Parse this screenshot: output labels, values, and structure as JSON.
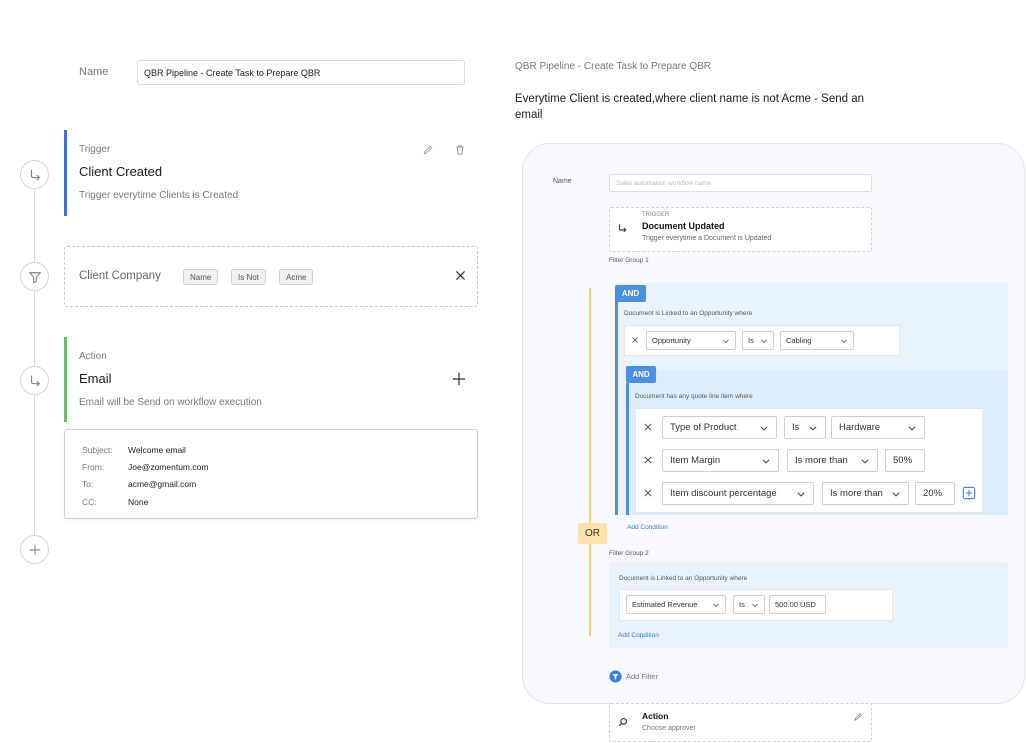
{
  "form": {
    "name_label": "Name",
    "name_value": "QBR Pipeline - Create Task to Prepare QBR"
  },
  "trigger": {
    "eyebrow": "Trigger",
    "title": "Client Created",
    "subtitle": "Trigger everytime Clients is Created",
    "accent": "#3b6fe0"
  },
  "filter": {
    "field": "Client Company",
    "chips": [
      "Name",
      "Is Not",
      "Acme"
    ]
  },
  "action": {
    "eyebrow": "Action",
    "title": "Email",
    "subtitle": "Email will be Send on workflow execution",
    "accent": "#6cc070"
  },
  "email": {
    "rows": [
      {
        "k": "Subject:",
        "v": "Welcome email"
      },
      {
        "k": "From:",
        "v": "Joe@zomentum.com"
      },
      {
        "k": "To:",
        "v": "acme@gmail.com"
      },
      {
        "k": "CC:",
        "v": "None"
      }
    ]
  },
  "right": {
    "crumb": "QBR Pipeline - Create Task to Prepare QBR",
    "description": "Everytime Client is created,where client name is not Acme - Send an email"
  },
  "screen": {
    "name_label": "Name",
    "name_placeholder": "Sales automation workflow name",
    "trigger_eyebrow": "TRIGGER",
    "trigger_title": "Document Updated",
    "trigger_sub": "Trigger everytime a  Document is Updated",
    "filter_group_1": "Filter Group 1",
    "and_label": "AND",
    "and_label_2": "AND",
    "group1_caption": "Document is Linked to an Opportunity where",
    "group1_row": {
      "field": "Opportunity",
      "op": "Is",
      "value": "Cabling"
    },
    "subgroup_caption": "Document has any quote line item where",
    "conditions": [
      {
        "field": "Type of Product",
        "op": "Is",
        "value": "Hardware"
      },
      {
        "field": "Item Margin",
        "op": "Is more than",
        "value": "50%"
      },
      {
        "field": "Item discount percentage",
        "op": "Is more than",
        "value": "20%"
      }
    ],
    "add_condition": "Add Condition",
    "or_label": "OR",
    "filter_group_2": "Filter Group 2",
    "group2_caption": "Document is Linked to an Opportunity where",
    "group2_row": {
      "field": "Estimated Revenue",
      "op": "Is",
      "value": "500.00 USD"
    },
    "add_condition_2": "Add Condition",
    "add_filter": "Add Filter",
    "action_title": "Action",
    "action_sub": "Choose approver"
  },
  "colors": {
    "accent_blue": "#4a90e2",
    "or_yellow": "#fde3a7",
    "group_bg": "#e9f3fc",
    "link_blue": "#3b7ae8"
  }
}
